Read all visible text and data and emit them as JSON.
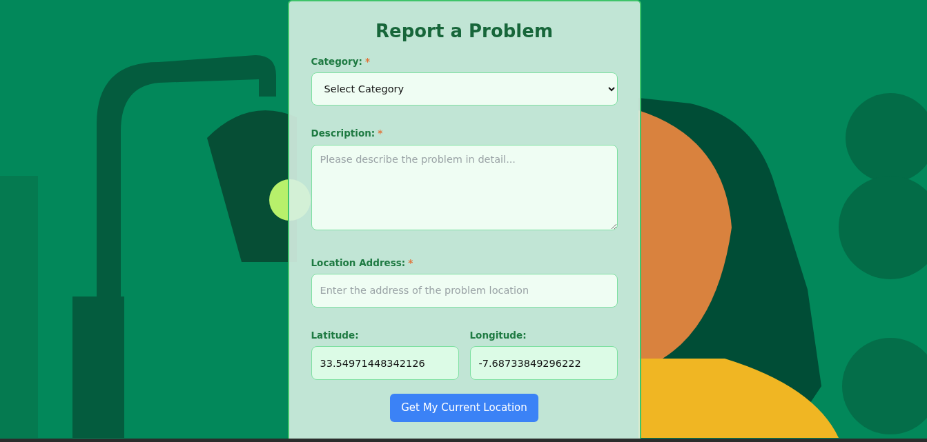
{
  "form": {
    "title": "Report a Problem",
    "fields": [
      {
        "kind": "select",
        "label": "Category:",
        "required_mark": "*",
        "value": "Select Category"
      },
      {
        "kind": "textarea",
        "label": "Description:",
        "required_mark": "*",
        "placeholder": "Please describe the problem in detail..."
      },
      {
        "kind": "input",
        "label": "Location Address:",
        "required_mark": "*",
        "placeholder": "Enter the address of the problem location"
      }
    ],
    "coordinates": [
      {
        "label": "Latitude:",
        "value": "33.54971448342126"
      },
      {
        "label": "Longitude:",
        "value": "-7.68733849296222"
      }
    ],
    "location_button": "Get My Current Location"
  }
}
